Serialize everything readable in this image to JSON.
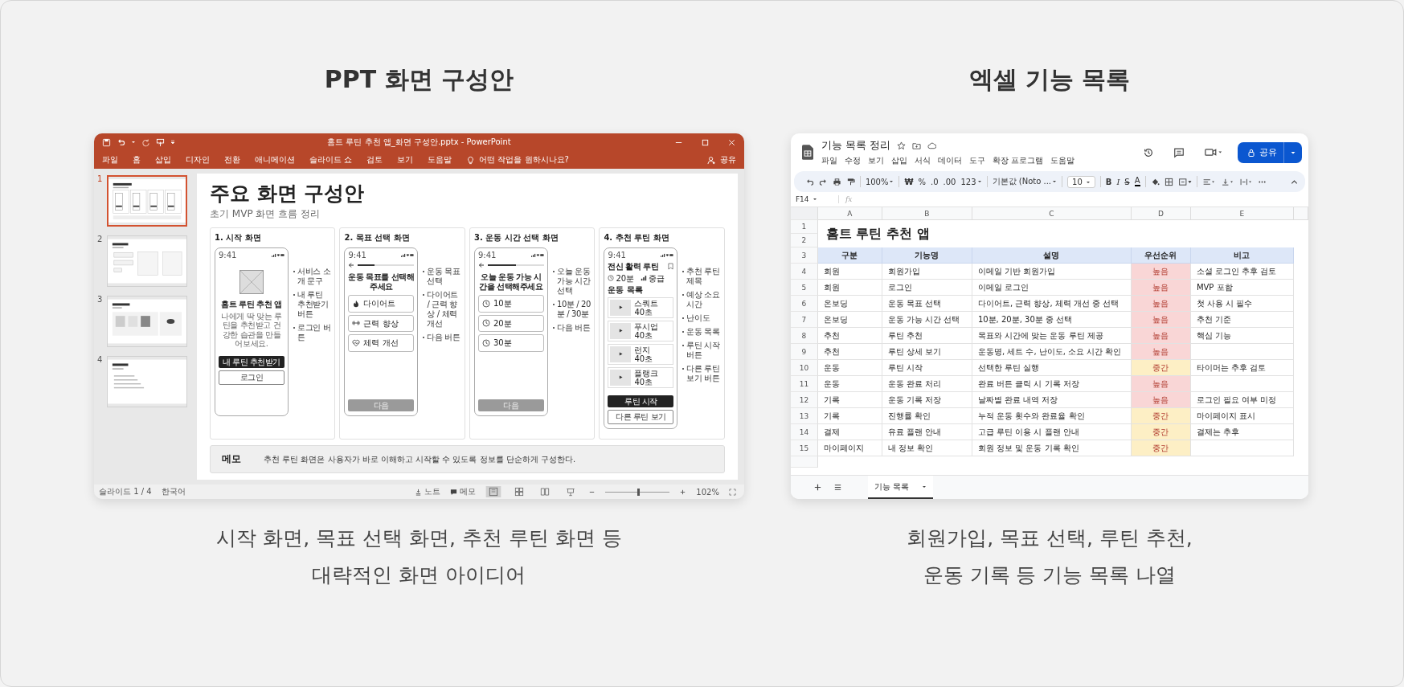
{
  "left": {
    "heading": "PPT 화면 구성안",
    "caption": [
      "시작 화면, 목표 선택 화면, 추천 루틴 화면 등",
      "대략적인 화면 아이디어"
    ]
  },
  "ppt": {
    "title": "홈트 루틴 추천 앱_화면 구성안.pptx - PowerPoint",
    "tabs": [
      "파일",
      "홈",
      "삽입",
      "디자인",
      "전환",
      "애니메이션",
      "슬라이드 쇼",
      "검토",
      "보기",
      "도움말"
    ],
    "search_hint": "어떤 작업을 원하시나요?",
    "share": "공유",
    "thumbnails": [
      {
        "number": "1",
        "kind": "panels",
        "selected": true
      },
      {
        "number": "2",
        "kind": "flow",
        "selected": false
      },
      {
        "number": "3",
        "kind": "gallery",
        "selected": false
      },
      {
        "number": "4",
        "kind": "list",
        "selected": false
      }
    ],
    "slide": {
      "title": "주요 화면 구성안",
      "subtitle": "초기 MVP 화면 흐름 정리",
      "panels": [
        {
          "kind": "start",
          "title": "1. 시작 화면",
          "time": "9:41",
          "app_title": "홈트 루틴 추천 앱",
          "description": "나에게 딱 맞는 루틴을 추천받고 건강한 습관을 만들어보세요.",
          "primary": "내 루틴 추천받기",
          "secondary": "로그인",
          "notes": [
            "서비스 소개 문구",
            "내 루틴 추천받기 버튼",
            "로그인 버튼"
          ]
        },
        {
          "kind": "goal",
          "title": "2. 목표 선택 화면",
          "time": "9:41",
          "progress": {
            "level": 0.3
          },
          "prompt": "운동 목표를 선택해주세요",
          "options": [
            "다이어트",
            "근력 향상",
            "체력 개선"
          ],
          "next": "다음",
          "notes": [
            "운동 목표 선택",
            "다이어트 / 근력 향상 / 체력 개선",
            "다음 버튼"
          ]
        },
        {
          "kind": "time",
          "title": "3. 운동 시간 선택 화면",
          "time": "9:41",
          "progress": {
            "level": 0.5
          },
          "prompt": "오늘 운동 가능 시간을 선택해주세요",
          "options": [
            "10분",
            "20분",
            "30분"
          ],
          "next": "다음",
          "notes": [
            "오늘 운동 가능 시간 선택",
            "10분 / 20분 / 30분",
            "다음 버튼"
          ]
        },
        {
          "kind": "routine",
          "title": "4. 추천 루틴 화면",
          "time": "9:41",
          "routine_title": "전신 활력 루틴",
          "duration": "20분",
          "difficulty": "중급",
          "list_label": "운동 목록",
          "exercises": [
            {
              "name": "스쿼트",
              "duration": "40초"
            },
            {
              "name": "푸시업",
              "duration": "40초"
            },
            {
              "name": "런지",
              "duration": "40초"
            },
            {
              "name": "플랭크",
              "duration": "40초"
            }
          ],
          "primary": "루틴 시작",
          "secondary": "다른 루틴 보기",
          "notes": [
            "추천 루틴 제목",
            "예상 소요 시간",
            "난이도",
            "운동 목록",
            "루틴 시작 버튼",
            "다른 루틴 보기 버튼"
          ]
        }
      ],
      "memo": {
        "label": "메모",
        "text": "추천 루틴 화면은 사용자가 바로 이해하고 시작할 수 있도록 정보를 단순하게 구성한다."
      }
    },
    "status": {
      "slide": "슬라이드 1 / 4",
      "language": "한국어",
      "notes": "노트",
      "comments": "메모",
      "views": [
        {
          "kind": "normal",
          "selected": true
        },
        {
          "kind": "sorter",
          "selected": false
        },
        {
          "kind": "reading",
          "selected": false
        },
        {
          "kind": "show",
          "selected": false
        }
      ],
      "zoom_slider": {
        "level": 0.5
      },
      "zoom": "102%"
    }
  },
  "right": {
    "heading": "엑셀 기능 목록",
    "caption": [
      "회원가입, 목표 선택, 루틴 추천,",
      "운동 기록 등 기능 목록 나열"
    ]
  },
  "sheet": {
    "title": "기능 목록 정리",
    "menu": [
      "파일",
      "수정",
      "보기",
      "삽입",
      "서식",
      "데이터",
      "도구",
      "확장 프로그램",
      "도움말"
    ],
    "share": "공유",
    "toolbar": {
      "zoom": "100%",
      "currency": "₩",
      "percent": "%",
      "dec_less": ".0",
      "dec_more": ".00",
      "number_format": "123",
      "font": "기본값 (Noto ...",
      "font_size": "10",
      "bold": "B",
      "italic": "I",
      "strike": "S",
      "text_color": "A"
    },
    "name_box": "F14",
    "fx": "fx",
    "columns": [
      "A",
      "B",
      "C",
      "D",
      "E"
    ],
    "title_rows": [
      "1",
      "2"
    ],
    "doc_heading": "홈트 루틴 추천 앱",
    "header": {
      "number": "3",
      "cells": [
        "구분",
        "기능명",
        "설명",
        "우선순위",
        "비고"
      ]
    },
    "rows": [
      {
        "number": "4",
        "category": "회원",
        "feature": "회원가입",
        "description": "이메일 기반 회원가입",
        "priority": "높음",
        "kind": "high",
        "note": "소셜 로그인 추후 검토"
      },
      {
        "number": "5",
        "category": "회원",
        "feature": "로그인",
        "description": "이메일 로그인",
        "priority": "높음",
        "kind": "high",
        "note": "MVP 포함"
      },
      {
        "number": "6",
        "category": "온보딩",
        "feature": "운동 목표 선택",
        "description": "다이어트, 근력 향상, 체력 개선 중 선택",
        "priority": "높음",
        "kind": "high",
        "note": "첫 사용 시 필수"
      },
      {
        "number": "7",
        "category": "온보딩",
        "feature": "운동 가능 시간 선택",
        "description": "10분, 20분, 30분 중 선택",
        "priority": "높음",
        "kind": "high",
        "note": "추천 기준"
      },
      {
        "number": "8",
        "category": "추천",
        "feature": "루틴 추천",
        "description": "목표와 시간에 맞는 운동 루틴 제공",
        "priority": "높음",
        "kind": "high",
        "note": "핵심 기능"
      },
      {
        "number": "9",
        "category": "추천",
        "feature": "루틴 상세 보기",
        "description": "운동명, 세트 수, 난이도, 소요 시간 확인",
        "priority": "높음",
        "kind": "high"
      },
      {
        "number": "10",
        "category": "운동",
        "feature": "루틴 시작",
        "description": "선택한 루틴 실행",
        "priority": "중간",
        "kind": "medium",
        "note": "타이머는 추후 검토"
      },
      {
        "number": "11",
        "category": "운동",
        "feature": "운동 완료 처리",
        "description": "완료 버튼 클릭 시 기록 저장",
        "priority": "높음",
        "kind": "high"
      },
      {
        "number": "12",
        "category": "기록",
        "feature": "운동 기록 저장",
        "description": "날짜별 완료 내역 저장",
        "priority": "높음",
        "kind": "high",
        "note": "로그인 필요 여부 미정"
      },
      {
        "number": "13",
        "category": "기록",
        "feature": "진행률 확인",
        "description": "누적 운동 횟수와 완료율 확인",
        "priority": "중간",
        "kind": "medium",
        "note": "마이페이지 표시"
      },
      {
        "number": "14",
        "category": "결제",
        "feature": "유료 플랜 안내",
        "description": "고급 루틴 이용 시 플랜 안내",
        "priority": "중간",
        "kind": "medium",
        "note": "결제는 추후"
      },
      {
        "number": "15",
        "category": "마이페이지",
        "feature": "내 정보 확인",
        "description": "회원 정보 및 운동 기록 확인",
        "priority": "중간",
        "kind": "medium"
      }
    ],
    "sheet_tabs": [
      {
        "label": "기능 목록",
        "selected": true
      }
    ]
  }
}
